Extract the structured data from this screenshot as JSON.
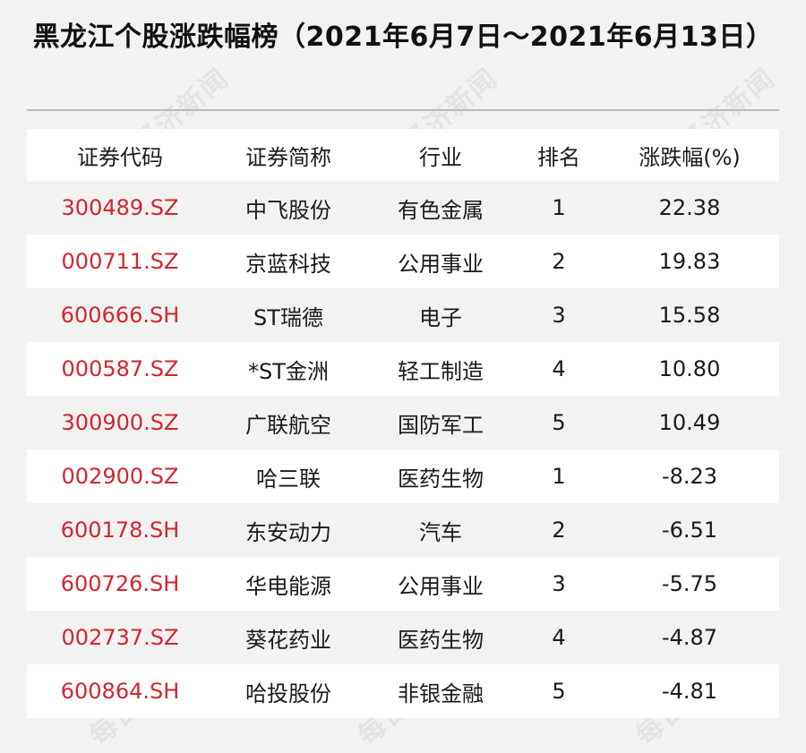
{
  "title": "黑龙江个股涨跌幅榜（2021年6月7日～2021年6月13日）",
  "watermark": "每日经济新闻",
  "columns": [
    "证券代码",
    "证券简称",
    "行业",
    "排名",
    "涨跌幅(%)"
  ],
  "rows": [
    {
      "code": "300489.SZ",
      "name": "中飞股份",
      "industry": "有色金属",
      "rank": "1",
      "change": "22.38"
    },
    {
      "code": "000711.SZ",
      "name": "京蓝科技",
      "industry": "公用事业",
      "rank": "2",
      "change": "19.83"
    },
    {
      "code": "600666.SH",
      "name": "ST瑞德",
      "industry": "电子",
      "rank": "3",
      "change": "15.58"
    },
    {
      "code": "000587.SZ",
      "name": "*ST金洲",
      "industry": "轻工制造",
      "rank": "4",
      "change": "10.80"
    },
    {
      "code": "300900.SZ",
      "name": "广联航空",
      "industry": "国防军工",
      "rank": "5",
      "change": "10.49"
    },
    {
      "code": "002900.SZ",
      "name": "哈三联",
      "industry": "医药生物",
      "rank": "1",
      "change": "-8.23"
    },
    {
      "code": "600178.SH",
      "name": "东安动力",
      "industry": "汽车",
      "rank": "2",
      "change": "-6.51"
    },
    {
      "code": "600726.SH",
      "name": "华电能源",
      "industry": "公用事业",
      "rank": "3",
      "change": "-5.75"
    },
    {
      "code": "002737.SZ",
      "name": "葵花药业",
      "industry": "医药生物",
      "rank": "4",
      "change": "-4.87"
    },
    {
      "code": "600864.SH",
      "name": "哈投股份",
      "industry": "非银金融",
      "rank": "5",
      "change": "-4.81"
    }
  ],
  "colors": {
    "code_red": "#d2262d",
    "row_white": "#ffffff",
    "row_gray": "#f2f2f2",
    "background": "#f2f2f2"
  }
}
